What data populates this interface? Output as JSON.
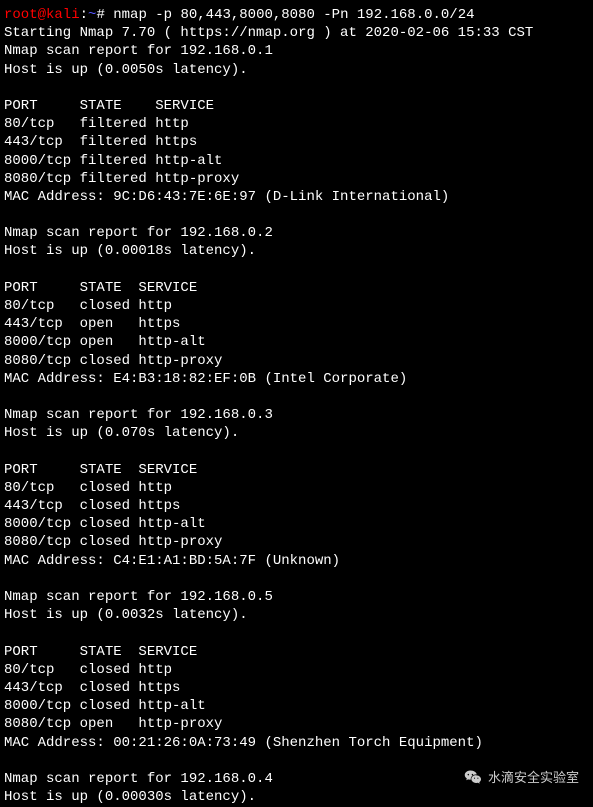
{
  "prompt": {
    "user_host": "root@kali",
    "separator": ":",
    "path": "~",
    "hash": "# ",
    "command": "nmap -p 80,443,8000,8080 -Pn 192.168.0.0/24"
  },
  "intro": {
    "starting": "Starting Nmap 7.70 ( https://nmap.org ) at 2020-02-06 15:33 CST"
  },
  "hosts": [
    {
      "report": "Nmap scan report for 192.168.0.1",
      "hostup": "Host is up (0.0050s latency).",
      "header": "PORT     STATE    SERVICE",
      "ports": [
        "80/tcp   filtered http",
        "443/tcp  filtered https",
        "8000/tcp filtered http-alt",
        "8080/tcp filtered http-proxy"
      ],
      "mac": "MAC Address: 9C:D6:43:7E:6E:97 (D-Link International)"
    },
    {
      "report": "Nmap scan report for 192.168.0.2",
      "hostup": "Host is up (0.00018s latency).",
      "header": "PORT     STATE  SERVICE",
      "ports": [
        "80/tcp   closed http",
        "443/tcp  open   https",
        "8000/tcp open   http-alt",
        "8080/tcp closed http-proxy"
      ],
      "mac": "MAC Address: E4:B3:18:82:EF:0B (Intel Corporate)"
    },
    {
      "report": "Nmap scan report for 192.168.0.3",
      "hostup": "Host is up (0.070s latency).",
      "header": "PORT     STATE  SERVICE",
      "ports": [
        "80/tcp   closed http",
        "443/tcp  closed https",
        "8000/tcp closed http-alt",
        "8080/tcp closed http-proxy"
      ],
      "mac": "MAC Address: C4:E1:A1:BD:5A:7F (Unknown)"
    },
    {
      "report": "Nmap scan report for 192.168.0.5",
      "hostup": "Host is up (0.0032s latency).",
      "header": "PORT     STATE  SERVICE",
      "ports": [
        "80/tcp   closed http",
        "443/tcp  closed https",
        "8000/tcp closed http-alt",
        "8080/tcp open   http-proxy"
      ],
      "mac": "MAC Address: 00:21:26:0A:73:49 (Shenzhen Torch Equipment)"
    },
    {
      "report": "Nmap scan report for 192.168.0.4",
      "hostup": "Host is up (0.00030s latency)."
    }
  ],
  "watermark": {
    "text": "水滴安全实验室"
  }
}
